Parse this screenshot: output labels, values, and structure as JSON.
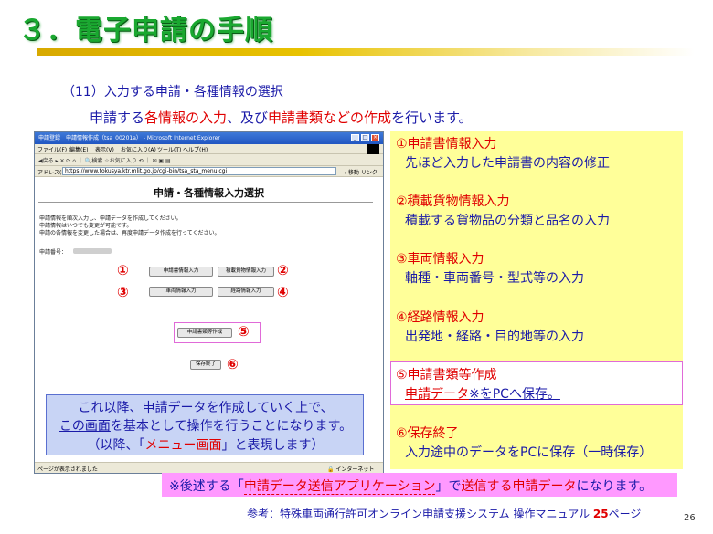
{
  "slide": {
    "title": "３．電子申請の手順",
    "subtitle": "（11）入力する申請・各種情報の選択",
    "lead": {
      "p1": "申請する",
      "p2": "各情報の入力",
      "p3": "、及び",
      "p4": "申請書類などの作成",
      "p5": "を行います。"
    },
    "page_number": "26"
  },
  "browser": {
    "window_title": "申請登録　申請情報作成（tsa_00201a） - Microsoft Internet Explorer",
    "menu": [
      "ファイル(F)",
      "編集(E)",
      "表示(V)",
      "お気に入り(A)",
      "ツール(T)",
      "ヘルプ(H)"
    ],
    "toolbar_text": "◀戻る ▸ ✕ ⟳ ⌂ ｜ 🔍検索 ☆お気に入り ⟲ ｜ ✉ ▣ ▤",
    "address_label": "アドレス(D)",
    "address_value": "https://www.tokusya.ktr.mlit.go.jp/cgi-bin/tsa_sta_menu.cgi",
    "go_label": "→ 移動 リンク",
    "status_left": "ページが表示されました",
    "status_right": "🔒 インターネット",
    "page": {
      "heading": "申請・各種情報入力選択",
      "info_lines": [
        "申請情報を順次入力し、申請データを作成してください。",
        "申請情報はいつでも変更が可能です。",
        "申請の各情報を変更した場合は、再度申請データ作成を行ってください。"
      ],
      "app_no_label": "申請番号："
    },
    "buttons": {
      "b1": "申請書情報入力",
      "b2": "積載貨物情報入力",
      "b3": "車両情報入力",
      "b4": "経路情報入力",
      "b5": "申請書類等作成",
      "b6": "保存終了"
    },
    "markers": {
      "m1": "①",
      "m2": "②",
      "m3": "③",
      "m4": "④",
      "m5": "⑤",
      "m6": "⑥"
    }
  },
  "callout": {
    "line1": "これ以降、申請データを作成していく上で、",
    "line2a": "この画面",
    "line2b": "を基本として操作を行うことになります。",
    "line3a": "（以降、「",
    "line3b": "メニュー画面",
    "line3c": "」と表現します）"
  },
  "steps": [
    {
      "title": "①申請書情報入力",
      "desc": "先ほど入力した申請書の内容の修正"
    },
    {
      "title": "②積載貨物情報入力",
      "desc": "積載する貨物品の分類と品名の入力"
    },
    {
      "title": "③車両情報入力",
      "desc": "軸種・車両番号・型式等の入力"
    },
    {
      "title": "④経路情報入力",
      "desc": "出発地・経路・目的地等の入力"
    },
    {
      "title": "⑤申請書類等作成",
      "desc_a": "申請データ",
      "desc_b": "※をPCへ保存。"
    },
    {
      "title": "⑥保存終了",
      "desc": "入力途中のデータをPCに保存（一時保存）"
    }
  ],
  "note": {
    "a": "※後述する「",
    "b": "申請データ送信アプリケーション",
    "c": "」で",
    "d": "送信する申請データ",
    "e": "になります。"
  },
  "reference": {
    "a": "参考：特殊車両通行許可オンライン申請支援システム 操作マニュアル ",
    "b": "25",
    "c": "ページ"
  },
  "colors": {
    "title_green": "#1aa830",
    "text_blue": "#1a1aa8",
    "accent_red": "#e00000",
    "panel_yellow": "#ffff99",
    "note_pink": "#ff99ff",
    "callout_blue": "#c8d4f5"
  }
}
